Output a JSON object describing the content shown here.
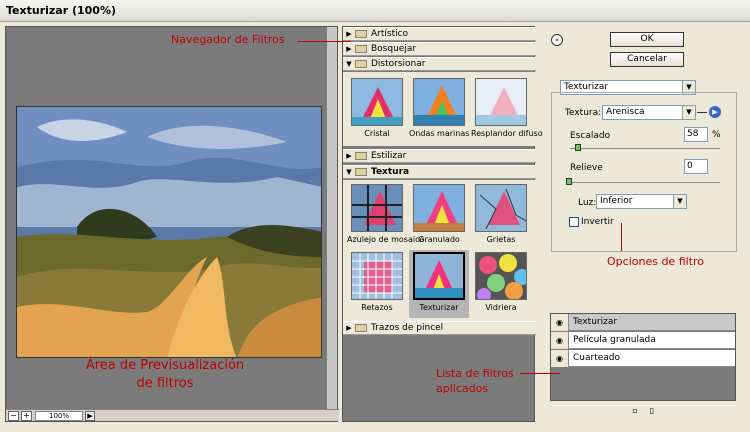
{
  "window": {
    "title": "Texturizar (100%)"
  },
  "preview": {
    "zoom": "100%",
    "zoom_out": "−",
    "zoom_in": "+",
    "menu_arrow": "▶"
  },
  "browser": {
    "categories": [
      {
        "label": "Artístico",
        "expanded": false
      },
      {
        "label": "Bosquejar",
        "expanded": false
      },
      {
        "label": "Distorsionar",
        "expanded": true
      },
      {
        "label": "Estilizar",
        "expanded": false
      },
      {
        "label": "Textura",
        "expanded": true
      },
      {
        "label": "Trazos de pincel",
        "expanded": false
      }
    ],
    "distorsionar_filters": [
      "Cristal",
      "Ondas marinas",
      "Resplandor difuso"
    ],
    "textura_filters": [
      "Azulejo de mosaico",
      "Granulado",
      "Grietas",
      "Retazos",
      "Texturizar",
      "Vidriera"
    ],
    "selected_filter": "Texturizar"
  },
  "buttons": {
    "collapse": "«",
    "ok": "OK",
    "cancel": "Cancelar"
  },
  "options": {
    "filter_select": "Texturizar",
    "texture_label": "Textura:",
    "texture_value": "Arenisca",
    "scaling_label": "Escalado",
    "scaling_value": "58",
    "scaling_unit": "%",
    "relief_label": "Relieve",
    "relief_value": "0",
    "light_label": "Luz:",
    "light_value": "Inferior",
    "invert_label": "Invertir",
    "invert_checked": false
  },
  "applied_filters": [
    {
      "label": "Texturizar",
      "selected": true
    },
    {
      "label": "Película granulada",
      "selected": false
    },
    {
      "label": "Cuarteado",
      "selected": false
    }
  ],
  "annotations": {
    "browser": "Navegador de Filtros",
    "preview_line1": "Área de Previsualización",
    "preview_line2": "de filtros",
    "options": "Opciones de filtro",
    "list_line1": "Lista de filtros",
    "list_line2": "aplicados"
  },
  "colors": {
    "annotation": "#c00000",
    "panel_gray": "#7b7b7b",
    "window": "#ece9d8"
  }
}
